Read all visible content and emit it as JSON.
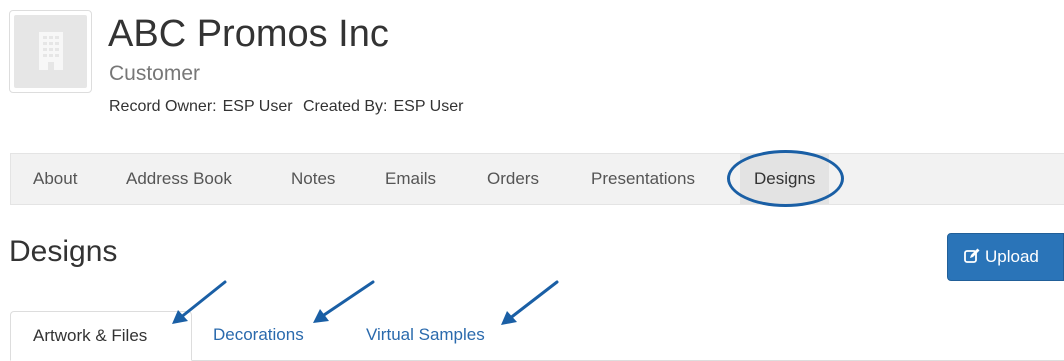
{
  "header": {
    "company_name": "ABC Promos Inc",
    "record_type": "Customer",
    "record_owner_label": "Record Owner:",
    "record_owner": "ESP User",
    "created_by_label": "Created By:",
    "created_by": "ESP User",
    "avatar_icon": "building-icon"
  },
  "nav": {
    "items": [
      {
        "label": "About"
      },
      {
        "label": "Address Book"
      },
      {
        "label": "Notes"
      },
      {
        "label": "Emails"
      },
      {
        "label": "Orders"
      },
      {
        "label": "Presentations"
      },
      {
        "label": "Designs",
        "active": true
      }
    ]
  },
  "section": {
    "title": "Designs",
    "upload_label": "Upload",
    "upload_icon": "edit-icon"
  },
  "tabs": {
    "items": [
      {
        "label": "Artwork & Files",
        "active": true
      },
      {
        "label": "Decorations"
      },
      {
        "label": "Virtual Samples"
      }
    ]
  },
  "colors": {
    "accent": "#2a74b8",
    "link": "#2a6aad",
    "annotation": "#1a5fa5"
  }
}
